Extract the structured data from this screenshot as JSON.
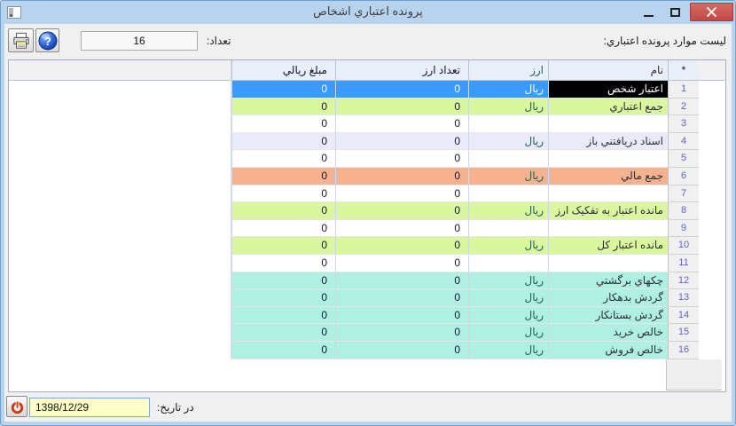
{
  "window": {
    "title": "پرونده اعتباري اشخاص"
  },
  "toolbar": {
    "list_label": "ليست موارد پرونده اعتباري:",
    "count_label": "تعداد:",
    "count_value": "16",
    "print_icon": "printer",
    "help_icon": "help-question"
  },
  "table": {
    "headers": {
      "row_marker": "*",
      "name": "نام",
      "currency": "ارز",
      "currency_count": "تعداد ارز",
      "rial_amount": "مبلغ ريالي"
    },
    "rows": [
      {
        "num": "1",
        "name": "اعتبار شخص",
        "currency": "ريال",
        "currency_count": "0",
        "rial_amount": "0",
        "band": "selected"
      },
      {
        "num": "2",
        "name": "جمع اعتباري",
        "currency": "ريال",
        "currency_count": "0",
        "rial_amount": "0",
        "band": "green"
      },
      {
        "num": "3",
        "name": "",
        "currency": "",
        "currency_count": "0",
        "rial_amount": "0",
        "band": "plain"
      },
      {
        "num": "4",
        "name": "اسناد دريافتني باز",
        "currency": "ريال",
        "currency_count": "0",
        "rial_amount": "0",
        "band": "lavender"
      },
      {
        "num": "5",
        "name": "",
        "currency": "",
        "currency_count": "0",
        "rial_amount": "0",
        "band": "plain"
      },
      {
        "num": "6",
        "name": "جمع مالي",
        "currency": "ريال",
        "currency_count": "0",
        "rial_amount": "0",
        "band": "salmon"
      },
      {
        "num": "7",
        "name": "",
        "currency": "",
        "currency_count": "0",
        "rial_amount": "0",
        "band": "plain"
      },
      {
        "num": "8",
        "name": "مانده اعتبار به تفکيک ارز",
        "currency": "ريال",
        "currency_count": "0",
        "rial_amount": "0",
        "band": "green"
      },
      {
        "num": "9",
        "name": "",
        "currency": "",
        "currency_count": "0",
        "rial_amount": "0",
        "band": "plain"
      },
      {
        "num": "10",
        "name": "مانده اعتبار کل",
        "currency": "ريال",
        "currency_count": "0",
        "rial_amount": "0",
        "band": "green"
      },
      {
        "num": "11",
        "name": "",
        "currency": "",
        "currency_count": "0",
        "rial_amount": "0",
        "band": "plain"
      },
      {
        "num": "12",
        "name": "چکهاي برگشتي",
        "currency": "ريال",
        "currency_count": "0",
        "rial_amount": "0",
        "band": "cyan"
      },
      {
        "num": "13",
        "name": "گردش بدهکار",
        "currency": "ريال",
        "currency_count": "0",
        "rial_amount": "0",
        "band": "cyan"
      },
      {
        "num": "14",
        "name": "گردش بستانکار",
        "currency": "ريال",
        "currency_count": "0",
        "rial_amount": "0",
        "band": "cyan"
      },
      {
        "num": "15",
        "name": "خالص خريد",
        "currency": "ريال",
        "currency_count": "0",
        "rial_amount": "0",
        "band": "cyan"
      },
      {
        "num": "16",
        "name": "خالص فروش",
        "currency": "ريال",
        "currency_count": "0",
        "rial_amount": "0",
        "band": "cyan"
      }
    ]
  },
  "footer": {
    "date_label": "در تاريخ:",
    "date_value": "1398/12/29",
    "stop_icon": "power-red"
  },
  "colors": {
    "titlebar": "#b7d3ee",
    "close_button": "#cb4f4c",
    "selected_row": "#3b9afd",
    "selected_name_cell": "#000000",
    "band_green": "#daf7a0",
    "band_lavender": "#eaeafb",
    "band_salmon": "#f6b28e",
    "band_cyan": "#aef0e2",
    "row_number_text": "#5f5fd3",
    "date_field_bg": "#ffffc8"
  }
}
